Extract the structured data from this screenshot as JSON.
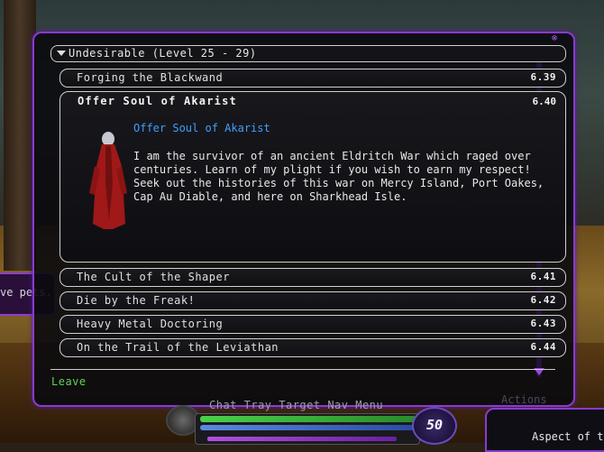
{
  "left_tab": {
    "text": "ve pets."
  },
  "window": {
    "group_header": "Undesirable (Level 25 - 29)",
    "missions": [
      {
        "label": "Forging the Blackwand",
        "number": "6.39"
      },
      {
        "label": "The Cult of the Shaper",
        "number": "6.41"
      },
      {
        "label": "Die by the Freak!",
        "number": "6.42"
      },
      {
        "label": "Heavy Metal Doctoring",
        "number": "6.43"
      },
      {
        "label": "On the Trail of the Leviathan",
        "number": "6.44"
      }
    ],
    "expanded": {
      "title": "Offer Soul of Akarist",
      "number": "6.40",
      "subtitle": "Offer Soul of Akarist",
      "description": "I am the survivor of an ancient Eldritch War which raged over centuries. Learn of my plight if you wish to earn my respect! Seek out the histories of this war on Mercy Island, Port Oakes, Cap Au Diable, and here on Sharkhead Isle."
    },
    "leave_label": "Leave"
  },
  "hud": {
    "tabs": "Chat  Tray  Target  Nav  Menu",
    "level": "50",
    "actions_label": "Actions",
    "aspect_text": "Aspect of th"
  }
}
